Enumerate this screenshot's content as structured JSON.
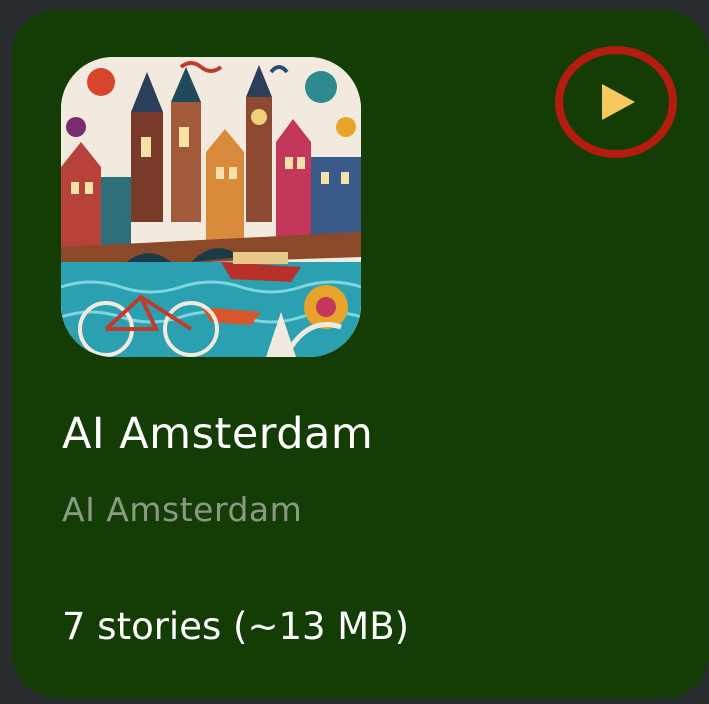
{
  "card": {
    "title": "AI Amsterdam",
    "subtitle": "AI Amsterdam",
    "meta": "7 stories (~13 MB)",
    "play_icon": "play-icon",
    "artwork_icon": "amsterdam-illustration"
  },
  "colors": {
    "card_background": "#143d05",
    "play_ring": "#b51c0f",
    "play_triangle": "#f6c85e",
    "subtitle_text": "#8a9a82"
  }
}
